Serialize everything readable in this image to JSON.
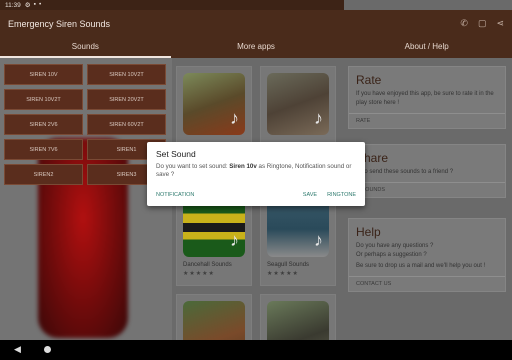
{
  "status": {
    "time": "11:39"
  },
  "app": {
    "title": "Emergency Siren Sounds"
  },
  "tabs": [
    {
      "label": "Sounds"
    },
    {
      "label": "More apps"
    },
    {
      "label": "About / Help"
    }
  ],
  "sirens": [
    "SIREN 10V",
    "SIREN 10V2T",
    "SIREN 10V2T",
    "SIREN 20V2T",
    "SIREN 2V6",
    "SIREN 60V2T",
    "SIREN 7V6",
    "SIREN1",
    "SIREN2",
    "SIREN3"
  ],
  "apps": [
    {
      "name": "",
      "stars": ""
    },
    {
      "name": "",
      "stars": ""
    },
    {
      "name": "Dancehall Sounds",
      "stars": "★★★★★"
    },
    {
      "name": "Seagull Sounds",
      "stars": "★★★★★"
    }
  ],
  "about": {
    "rate": {
      "title": "Rate",
      "text": "If you have enjoyed this app, be sure to rate it in the play store here !",
      "link": "RATE"
    },
    "share": {
      "title": "Share",
      "text": "... to send these sounds to a friend ?",
      "link": "D SOUNDS"
    },
    "help": {
      "title": "Help",
      "text1": "Do you have any questions ?",
      "text2": "Or perhaps a suggestion ?",
      "text3": "Be sure to drop us a mail and we'll help you out !",
      "link": "CONTACT US"
    }
  },
  "dialog": {
    "title": "Set Sound",
    "msg_prefix": "Do you want to set sound: ",
    "sound": "Siren 10v",
    "msg_suffix": " as Ringtone, Notification sound or save ?",
    "btn_notification": "NOTIFICATION",
    "btn_save": "SAVE",
    "btn_ringtone": "RINGTONE"
  },
  "colors": {
    "primary": "#4a2b1b",
    "accent": "#2e7a6e"
  }
}
